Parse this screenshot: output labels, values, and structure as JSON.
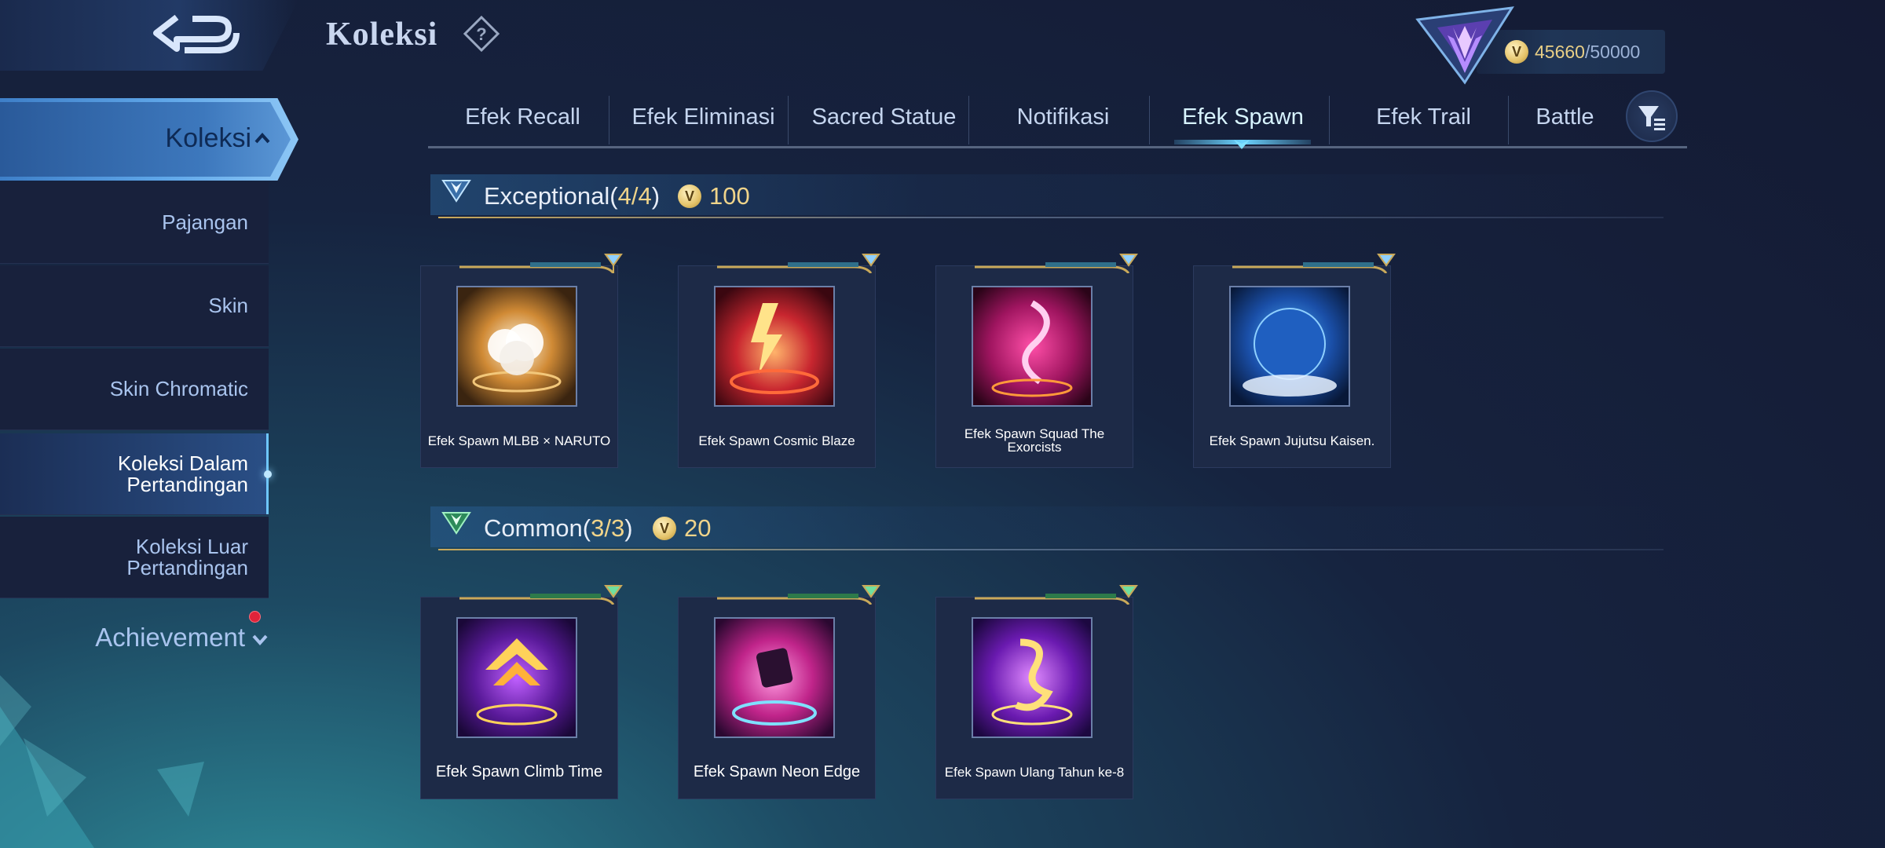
{
  "header": {
    "title": "Koleksi",
    "points_current": "45660",
    "points_max": "/50000"
  },
  "sidebar": {
    "main_label": "Koleksi",
    "items": [
      {
        "label": "Pajangan"
      },
      {
        "label": "Skin"
      },
      {
        "label": "Skin Chromatic"
      },
      {
        "label": "Koleksi Dalam Pertandingan",
        "active": true
      },
      {
        "label": "Koleksi Luar Pertandingan"
      }
    ],
    "achievement": "Achievement"
  },
  "tabs": [
    {
      "label": "Efek Recall"
    },
    {
      "label": "Efek Eliminasi"
    },
    {
      "label": "Sacred Statue"
    },
    {
      "label": "Notifikasi"
    },
    {
      "label": "Efek Spawn",
      "active": true
    },
    {
      "label": "Efek Trail"
    },
    {
      "label": "Battle"
    }
  ],
  "sections": [
    {
      "name": "Exceptional",
      "count_open": "(",
      "count": "4/4",
      "count_close": ")",
      "cost": "100",
      "items": [
        {
          "label": "Efek Spawn MLBB × NARUTO",
          "art": "naruto"
        },
        {
          "label": "Efek Spawn Cosmic Blaze",
          "art": "cosmic"
        },
        {
          "label": "Efek Spawn Squad The Exorcists",
          "art": "exorcists"
        },
        {
          "label": "Efek Spawn Jujutsu Kaisen.",
          "art": "jujutsu"
        }
      ]
    },
    {
      "name": "Common",
      "count_open": "(",
      "count": "3/3",
      "count_close": ")",
      "cost": "20",
      "items": [
        {
          "label": "Efek Spawn Climb Time",
          "art": "climb"
        },
        {
          "label": "Efek Spawn Neon Edge",
          "art": "neon"
        },
        {
          "label": "Efek Spawn Ulang Tahun ke-8",
          "art": "ulang"
        }
      ]
    }
  ],
  "colors": {
    "accent_gold": "#f0d48a",
    "active_blue": "#6cd4ff",
    "badge_red": "#e0233a"
  },
  "icons": [
    "back-arrow-icon",
    "help-icon",
    "rank-emblem-icon",
    "coin-icon",
    "chevron-up-icon",
    "chevron-down-icon",
    "filter-icon"
  ]
}
